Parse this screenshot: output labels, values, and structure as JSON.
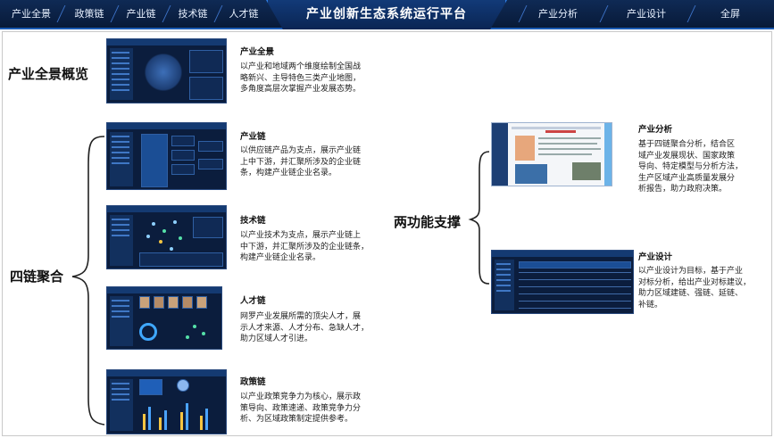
{
  "nav": {
    "left_items": [
      "产业全景",
      "政策链",
      "产业链",
      "技术链",
      "人才链"
    ],
    "title": "产业创新生态系统运行平台",
    "right_items": [
      "产业分析",
      "产业设计",
      "全屏"
    ]
  },
  "sections": {
    "overview": "产业全景概览",
    "four_chains": "四链聚合",
    "two_functions": "两功能支撑"
  },
  "items": {
    "panorama": {
      "title": "产业全景",
      "desc": [
        "以产业和地域两个维度绘制全国战",
        "略新兴、主导特色三类产业地图，",
        "多角度高层次掌握产业发展态势。"
      ]
    },
    "industry_chain": {
      "title": "产业链",
      "desc": [
        "以供应链产品为支点，展示产业链",
        "上中下游，并汇聚所涉及的企业链",
        "条，构建产业链企业名录。"
      ]
    },
    "tech_chain": {
      "title": "技术链",
      "desc": [
        "以产业技术为支点，展示产业链上",
        "中下游，并汇聚所涉及的企业链条，",
        "构建产业链企业名录。"
      ]
    },
    "talent_chain": {
      "title": "人才链",
      "desc": [
        "网罗产业发展所需的顶尖人才，展",
        "示人才来源、人才分布、急缺人才，",
        "助力区域人才引进。"
      ]
    },
    "policy_chain": {
      "title": "政策链",
      "desc": [
        "以产业政策竞争力为核心，展示政",
        "策导向、政策速递、政策竞争力分",
        "析、为区域政策制定提供参考。"
      ]
    },
    "industry_analysis": {
      "title": "产业分析",
      "desc": [
        "基于四链聚合分析，结合区",
        "域产业发展现状、国家政策",
        "导向、特定模型与分析方法，",
        "生产区域产业高质量发展分",
        "析报告，助力政府决策。"
      ]
    },
    "industry_design": {
      "title": "产业设计",
      "desc": [
        "以产业设计为目标，基于产业",
        "对标分析，给出产业对标建议，",
        "助力区域建链、强链、延链、",
        "补链。"
      ]
    }
  },
  "colors": {
    "nav_bg": "#0b2147",
    "nav_accent": "#1b5bb5",
    "thumb_bg": "#0b1d3d"
  }
}
